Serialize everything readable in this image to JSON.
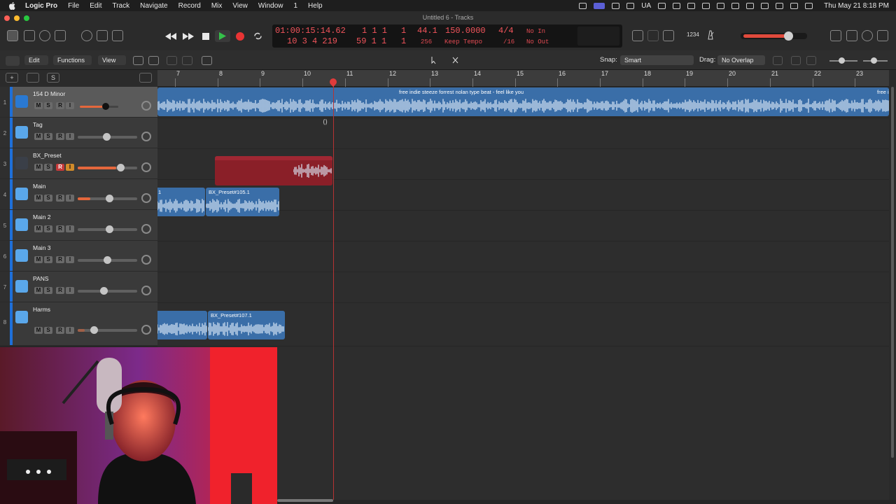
{
  "menubar": {
    "app": "Logic Pro",
    "items": [
      "File",
      "Edit",
      "Track",
      "Navigate",
      "Record",
      "Mix",
      "View",
      "Window",
      "1",
      "Help"
    ],
    "status_ua": "UA",
    "clock": "Thu May 21  8:18 PM"
  },
  "window": {
    "title": "Untitled 6 - Tracks"
  },
  "lcd": {
    "time": "01:00:15:14.62",
    "bars": "10  3  4  219",
    "pos_top": "1  1  1",
    "pos_top_sub": "1",
    "pos_bot": "59  1  1",
    "pos_bot_sub": "1",
    "sample_rate": "44.1",
    "buffer": "256",
    "tempo": "150.0000",
    "tempo_mode": "Keep Tempo",
    "signature": "4/4",
    "division": "/16",
    "midi_in": "No In",
    "midi_out": "No Out"
  },
  "toolbar": {
    "count_in": "1234"
  },
  "subbar": {
    "edit": "Edit",
    "functions": "Functions",
    "view": "View",
    "snap_label": "Snap:",
    "snap_value": "Smart",
    "drag_label": "Drag:",
    "drag_value": "No Overlap"
  },
  "header_buttons": {
    "add": "+",
    "solo_label": "S"
  },
  "tracks": [
    {
      "num": "1",
      "name": "154 D Minor",
      "record_enabled": false
    },
    {
      "num": "2",
      "name": "Tag",
      "record_enabled": false
    },
    {
      "num": "3",
      "name": "BX_Preset",
      "record_enabled": true
    },
    {
      "num": "4",
      "name": "Main",
      "record_enabled": false
    },
    {
      "num": "5",
      "name": "Main 2",
      "record_enabled": false
    },
    {
      "num": "6",
      "name": "Main 3",
      "record_enabled": false
    },
    {
      "num": "7",
      "name": "PANS",
      "record_enabled": false
    },
    {
      "num": "8",
      "name": "Harms",
      "record_enabled": false
    }
  ],
  "track_buttons": {
    "mute": "M",
    "solo": "S",
    "record": "R",
    "input": "I"
  },
  "ruler": {
    "bars": [
      "7",
      "8",
      "9",
      "10",
      "11",
      "12",
      "13",
      "14",
      "15",
      "16",
      "17",
      "18",
      "19",
      "20",
      "21",
      "22",
      "23"
    ]
  },
  "regions": {
    "beat": "free indie steeze  forrest nolan type beat - feel like you",
    "beat_tail": "free i",
    "main_a": "1",
    "main_b": "BX_Preset#105.1",
    "harms_b": "BX_Preset#107.1"
  },
  "colors": {
    "accent_blue": "#1e6fd9",
    "region_blue": "#3a6ea8",
    "record_red": "#c63a3a",
    "lcd_red": "#f2545b"
  }
}
